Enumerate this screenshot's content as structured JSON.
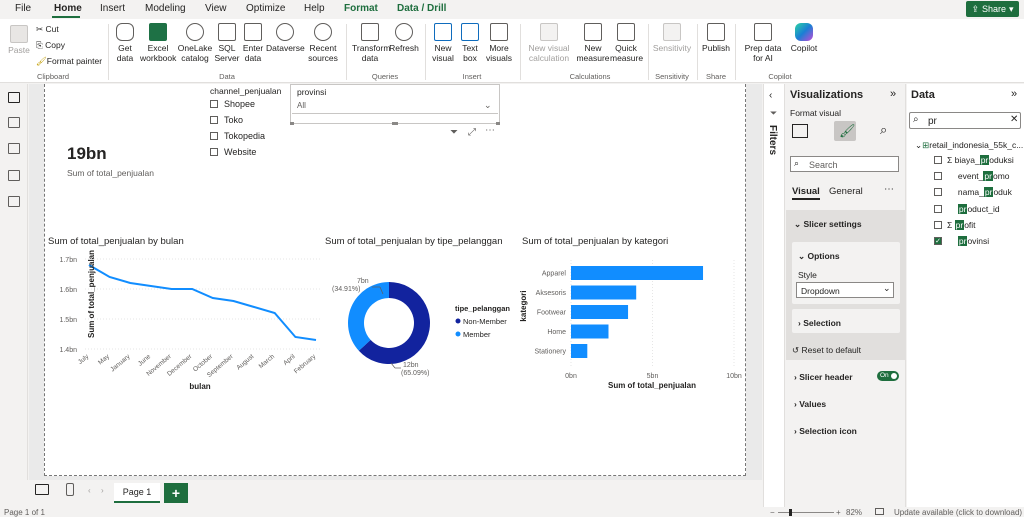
{
  "menu": {
    "items": [
      "File",
      "Home",
      "Insert",
      "Modeling",
      "View",
      "Optimize",
      "Help",
      "Format",
      "Data / Drill"
    ],
    "share": "Share"
  },
  "ribbon": {
    "clipboard": {
      "paste": "Paste",
      "cut": "Cut",
      "copy": "Copy",
      "format_painter": "Format painter",
      "label": "Clipboard"
    },
    "data": {
      "get_data": "Get data",
      "excel_workbook": "Excel workbook",
      "onelake": "OneLake catalog",
      "sql_server": "SQL Server",
      "enter_data": "Enter data",
      "dataverse": "Dataverse",
      "recent_sources": "Recent sources",
      "label": "Data"
    },
    "queries": {
      "transform": "Transform data",
      "refresh": "Refresh",
      "label": "Queries"
    },
    "insert": {
      "new_visual": "New visual",
      "text_box": "Text box",
      "more_visuals": "More visuals",
      "label": "Insert"
    },
    "calculations": {
      "new_visual_calc": "New visual calculation",
      "new_measure": "New measure",
      "quick_measure": "Quick measure",
      "label": "Calculations"
    },
    "sensitivity": {
      "sensitivity": "Sensitivity",
      "label": "Sensitivity"
    },
    "share": {
      "publish": "Publish",
      "label": "Share"
    },
    "copilot": {
      "prep": "Prep data for AI",
      "copilot": "Copilot",
      "label": "Copilot"
    }
  },
  "card": {
    "value": "19bn",
    "label": "Sum of total_penjualan"
  },
  "channel_slicer": {
    "title": "channel_penjualan",
    "options": [
      "Shopee",
      "Toko",
      "Tokopedia",
      "Website"
    ]
  },
  "provinsi_slicer": {
    "title": "provinsi",
    "value": "All"
  },
  "line_chart": {
    "title": "Sum of total_penjualan by bulan"
  },
  "donut_chart": {
    "title": "Sum of total_penjualan by tipe_pelanggan"
  },
  "bar_chart": {
    "title": "Sum of total_penjualan by kategori"
  },
  "chart_data": [
    {
      "type": "line",
      "title": "Sum of total_penjualan by bulan",
      "xlabel": "bulan",
      "ylabel": "Sum of total_penjualan",
      "categories": [
        "July",
        "May",
        "January",
        "June",
        "November",
        "December",
        "October",
        "September",
        "August",
        "March",
        "April",
        "February"
      ],
      "values": [
        1.68,
        1.64,
        1.62,
        1.61,
        1.6,
        1.6,
        1.57,
        1.56,
        1.54,
        1.52,
        1.44,
        1.43
      ],
      "ylim": [
        1.4,
        1.7
      ],
      "yticks": [
        "1.7bn",
        "1.6bn",
        "1.5bn",
        "1.4bn"
      ],
      "unit": "bn"
    },
    {
      "type": "pie",
      "title": "Sum of total_penjualan by tipe_pelanggan",
      "legend_title": "tipe_pelanggan",
      "series": [
        {
          "name": "Non-Member",
          "value": 12,
          "label": "12bn",
          "pct": "(65.09%)",
          "color": "#12239e"
        },
        {
          "name": "Member",
          "value": 7,
          "label": "7bn",
          "pct": "(34.91%)",
          "color": "#118dff"
        }
      ],
      "legend_position": "right"
    },
    {
      "type": "bar",
      "orientation": "horizontal",
      "title": "Sum of total_penjualan by kategori",
      "xlabel": "Sum of total_penjualan",
      "ylabel": "kategori",
      "categories": [
        "Apparel",
        "Aksesoris",
        "Footwear",
        "Home",
        "Stationery"
      ],
      "values": [
        8.1,
        4.0,
        3.5,
        2.3,
        1.0
      ],
      "xlim": [
        0,
        10
      ],
      "xticks": [
        "0bn",
        "5bn",
        "10bn"
      ],
      "color": "#118dff"
    }
  ],
  "pages": {
    "tab": "Page 1"
  },
  "status": {
    "left": "Page 1 of 1",
    "zoom": "82%",
    "update": "Update available (click to download)"
  },
  "filters": {
    "label": "Filters"
  },
  "visualizations": {
    "title": "Visualizations",
    "format_visual": "Format visual",
    "search_placeholder": "Search",
    "tabs": [
      "Visual",
      "General"
    ],
    "sections": {
      "slicer_settings": "Slicer settings",
      "options": "Options",
      "style_label": "Style",
      "style_value": "Dropdown",
      "selection": "Selection",
      "reset": "Reset to default",
      "slicer_header": "Slicer header",
      "toggle": "On",
      "values": "Values",
      "selection_icon": "Selection icon"
    }
  },
  "data_pane": {
    "title": "Data",
    "search_value": "pr",
    "table": "retail_indonesia_55k_c...",
    "fields": [
      {
        "pre": "biaya_",
        "hl": "pr",
        "post": "oduksi",
        "sigma": true,
        "checked": false
      },
      {
        "pre": "event_",
        "hl": "pr",
        "post": "omo",
        "sigma": false,
        "checked": false
      },
      {
        "pre": "nama_",
        "hl": "pr",
        "post": "oduk",
        "sigma": false,
        "checked": false
      },
      {
        "pre": "",
        "hl": "pr",
        "post": "oduct_id",
        "sigma": false,
        "checked": false
      },
      {
        "pre": "",
        "hl": "pr",
        "post": "ofit",
        "sigma": true,
        "checked": false
      },
      {
        "pre": "",
        "hl": "pr",
        "post": "ovinsi",
        "sigma": false,
        "checked": true
      }
    ]
  },
  "colors": {
    "accent": "#1e6e3e",
    "bar": "#118dff",
    "dark": "#12239e"
  }
}
